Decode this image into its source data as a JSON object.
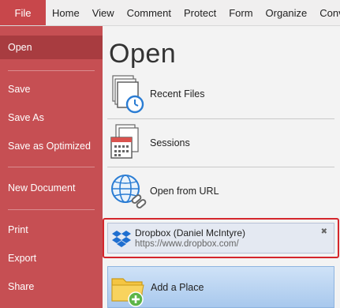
{
  "ribbon": {
    "file_tab": "File",
    "tabs": [
      "Home",
      "View",
      "Comment",
      "Protect",
      "Form",
      "Organize",
      "Conve"
    ]
  },
  "sidebar": {
    "items": [
      {
        "label": "Open",
        "active": true
      },
      {
        "label": "Save"
      },
      {
        "label": "Save As"
      },
      {
        "label": "Save as Optimized"
      },
      {
        "label": "New Document"
      },
      {
        "label": "Print"
      },
      {
        "label": "Export"
      },
      {
        "label": "Share"
      }
    ]
  },
  "main": {
    "title": "Open",
    "places": [
      {
        "label": "Recent Files",
        "icon": "recent-files-icon"
      },
      {
        "label": "Sessions",
        "icon": "sessions-icon"
      },
      {
        "label": "Open from URL",
        "icon": "globe-link-icon"
      }
    ],
    "dropbox": {
      "name": "Dropbox (Daniel McIntyre)",
      "url": "https://www.dropbox.com/",
      "close": "✖"
    },
    "add_place": {
      "label": "Add a Place"
    }
  },
  "colors": {
    "sidebar": "#c64f53",
    "sidebar_active": "#a83c40",
    "highlight_border": "#d4262c",
    "dropbox_blue": "#1f6fd0"
  }
}
